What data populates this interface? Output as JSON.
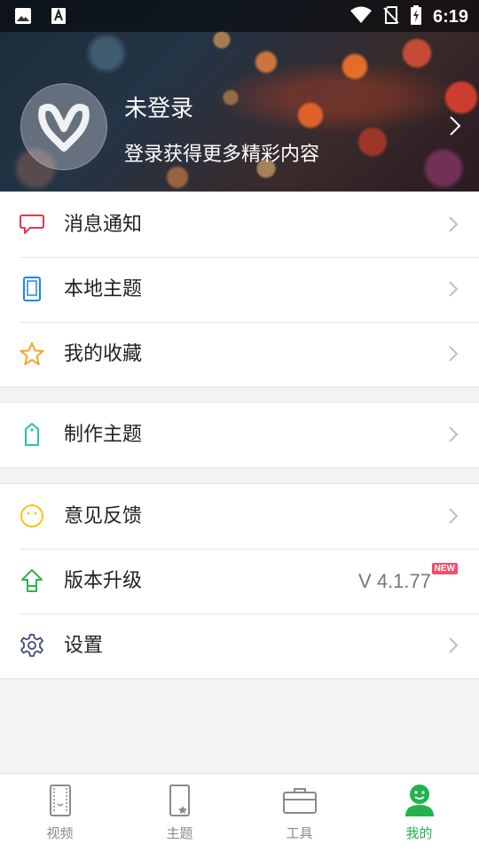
{
  "status_bar": {
    "time": "6:19",
    "icons": [
      "image-icon",
      "font-a-icon",
      "wifi-icon",
      "no-sim-icon",
      "battery-charging-icon"
    ]
  },
  "profile": {
    "name": "未登录",
    "subtitle": "登录获得更多精彩内容"
  },
  "menu": {
    "notifications": {
      "label": "消息通知",
      "icon": "message-bubble-icon"
    },
    "local_theme": {
      "label": "本地主题",
      "icon": "phone-icon"
    },
    "favorites": {
      "label": "我的收藏",
      "icon": "star-icon"
    },
    "make_theme": {
      "label": "制作主题",
      "icon": "shirt-tag-icon"
    },
    "feedback": {
      "label": "意见反馈",
      "icon": "smiley-icon"
    },
    "upgrade": {
      "label": "版本升级",
      "icon": "upload-arrow-icon",
      "version": "V 4.1.77",
      "badge": "NEW"
    },
    "settings": {
      "label": "设置",
      "icon": "gear-icon"
    }
  },
  "colors": {
    "accent_green": "#22b24c",
    "badge_red": "#f0506e"
  },
  "nav": [
    {
      "label": "视频",
      "icon": "video-icon",
      "active": false
    },
    {
      "label": "主题",
      "icon": "theme-icon",
      "active": false
    },
    {
      "label": "工具",
      "icon": "toolbox-icon",
      "active": false
    },
    {
      "label": "我的",
      "icon": "profile-icon",
      "active": true
    }
  ]
}
